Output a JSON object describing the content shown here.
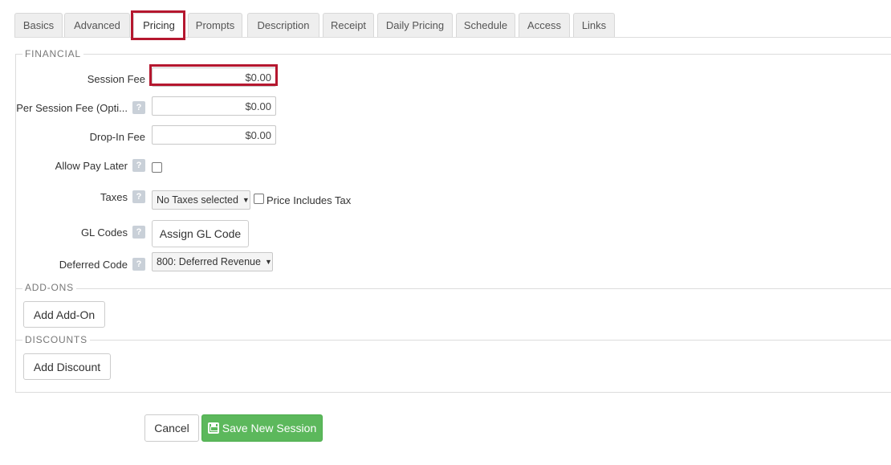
{
  "tabs": [
    {
      "label": "Basics"
    },
    {
      "label": "Advanced"
    },
    {
      "label": "Pricing"
    },
    {
      "label": "Prompts"
    },
    {
      "label": "Description"
    },
    {
      "label": "Receipt"
    },
    {
      "label": "Daily Pricing"
    },
    {
      "label": "Schedule"
    },
    {
      "label": "Access"
    },
    {
      "label": "Links"
    }
  ],
  "active_tab": "Pricing",
  "sections": {
    "financial": "FINANCIAL",
    "addons": "ADD-ONS",
    "discounts": "DISCOUNTS"
  },
  "fields": {
    "session_fee": {
      "label": "Session Fee",
      "value": "$0.00"
    },
    "per_session_fee": {
      "label": "Per Session Fee (Opti...",
      "value": "$0.00"
    },
    "drop_in_fee": {
      "label": "Drop-In Fee",
      "value": "$0.00"
    },
    "allow_pay_later": {
      "label": "Allow Pay Later",
      "checked": false
    },
    "taxes": {
      "label": "Taxes",
      "selected": "No Taxes selected",
      "price_includes_tax_label": "Price Includes Tax",
      "price_includes_tax_checked": false
    },
    "gl_codes": {
      "label": "GL Codes",
      "button": "Assign GL Code"
    },
    "deferred_code": {
      "label": "Deferred Code",
      "selected": "800: Deferred Revenue"
    }
  },
  "help_glyph": "?",
  "buttons": {
    "add_addon": "Add Add-On",
    "add_discount": "Add Discount",
    "cancel": "Cancel",
    "save": "Save New Session"
  },
  "colors": {
    "highlight": "#b5172f",
    "save_button": "#5cb85c"
  }
}
